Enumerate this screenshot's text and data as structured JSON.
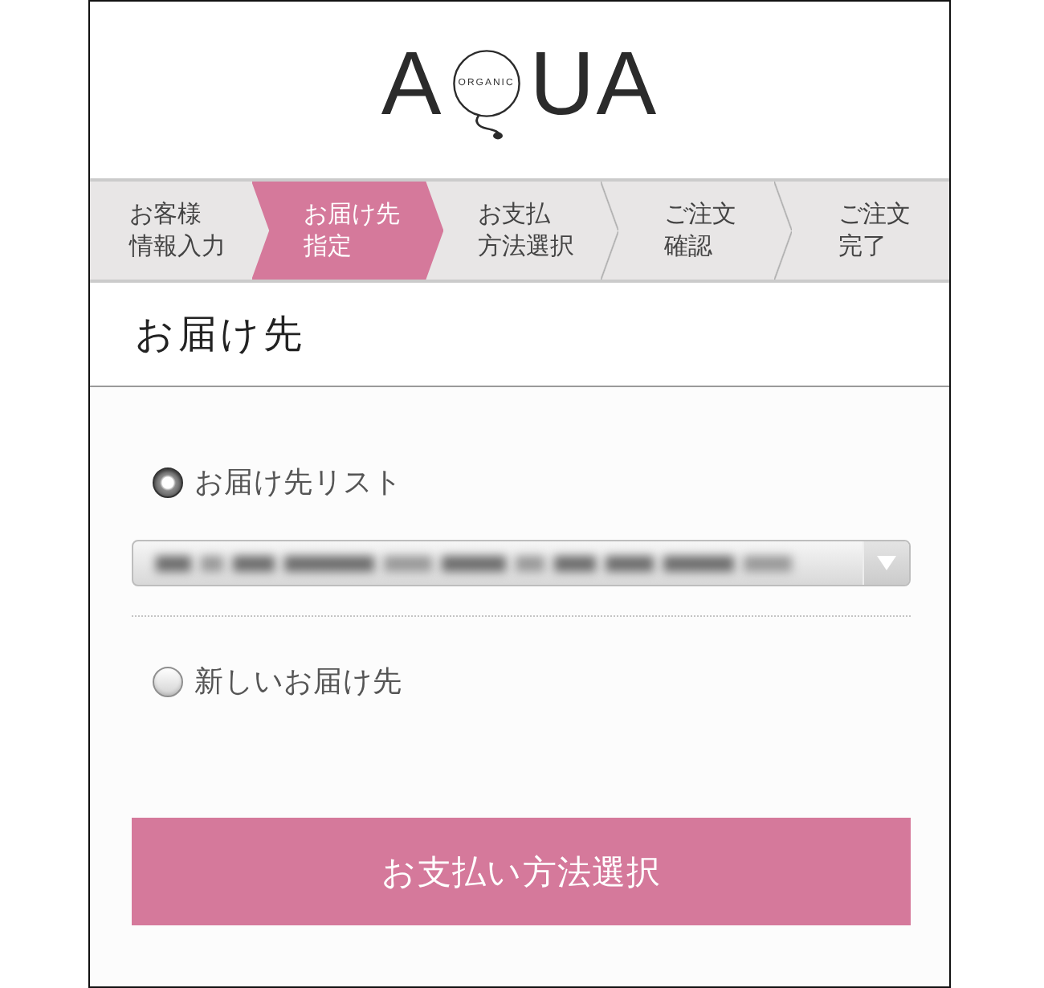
{
  "logo": {
    "letters_before": "A",
    "letters_after": "UA",
    "tagline": "ORGANIC"
  },
  "steps": [
    {
      "lines": [
        "お客様",
        "情報入力"
      ],
      "selected": false
    },
    {
      "lines": [
        "お届け先",
        "指定"
      ],
      "selected": true
    },
    {
      "lines": [
        "お支払",
        "方法選択"
      ],
      "selected": false
    },
    {
      "lines": [
        "ご注文",
        "確認"
      ],
      "selected": false
    },
    {
      "lines": [
        "ご注文",
        "完了"
      ],
      "selected": false
    }
  ],
  "section": {
    "title": "お届け先"
  },
  "delivery_options": [
    {
      "kind": "list",
      "label": "お届け先リスト",
      "selected": true
    },
    {
      "kind": "new",
      "label": "新しいお届け先",
      "selected": false
    }
  ],
  "submit_button": {
    "label": "お支払い方法選択"
  }
}
